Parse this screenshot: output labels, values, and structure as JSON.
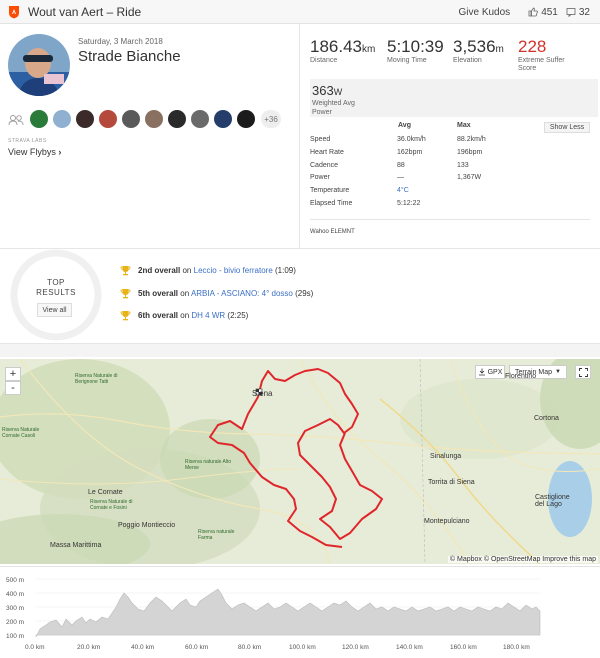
{
  "header": {
    "title": "Wout van Aert – Ride",
    "give_kudos": "Give Kudos",
    "kudos_count": "451",
    "comments_count": "32"
  },
  "activity": {
    "date": "Saturday, 3 March 2018",
    "name": "Strade Bianche",
    "more_athletes": "+36",
    "flyby_label": "STRAVA LABS",
    "flyby_link": "View Flybys"
  },
  "stats": {
    "distance": {
      "value": "186.43",
      "unit": "km",
      "label": "Distance"
    },
    "moving_time": {
      "value": "5:10:39",
      "label": "Moving Time"
    },
    "elevation": {
      "value": "3,536",
      "unit": "m",
      "label": "Elevation"
    },
    "suffer": {
      "value": "228",
      "label": "Extreme Suffer Score"
    },
    "power": {
      "value": "363",
      "unit": "W",
      "label": "Weighted Avg Power"
    },
    "show_less": "Show Less",
    "table": {
      "col_avg": "Avg",
      "col_max": "Max",
      "rows": [
        {
          "label": "Speed",
          "avg": "36.0km/h",
          "max": "88.2km/h"
        },
        {
          "label": "Heart Rate",
          "avg": "162bpm",
          "max": "196bpm"
        },
        {
          "label": "Cadence",
          "avg": "88",
          "max": "133"
        },
        {
          "label": "Power",
          "avg": "—",
          "max": "1,367W"
        },
        {
          "label": "Temperature",
          "avg": "4°C",
          "max": ""
        },
        {
          "label": "Elapsed Time",
          "avg": "5:12:22",
          "max": ""
        }
      ]
    },
    "device": "Wahoo ELEMNT"
  },
  "top_results": {
    "title_line1": "TOP",
    "title_line2": "RESULTS",
    "view_all": "View all",
    "items": [
      {
        "rank": "2nd overall",
        "on": "on",
        "segment": "Leccio - bivio ferratore",
        "time": "(1:09)"
      },
      {
        "rank": "5th overall",
        "on": "on",
        "segment": "ARBIA - ASCIANO: 4° dosso",
        "time": "(29s)"
      },
      {
        "rank": "6th overall",
        "on": "on",
        "segment": "DH 4 WR",
        "time": "(2:25)"
      }
    ]
  },
  "map": {
    "zoom_in": "+",
    "zoom_out": "-",
    "gpx": "GPX",
    "terrain": "Terrain Map",
    "labels": {
      "siena": "Siena",
      "sinalunga": "Sinalunga",
      "cortona": "Cortona",
      "florentino": "Florentino",
      "torrita": "Torrita di Siena",
      "montepulciano": "Montepulciano",
      "castiglione": "Castiglione del Lago",
      "le_cornate": "Le Cornate",
      "poggio": "Poggio Montieccio",
      "massa": "Massa Marittima",
      "reserve1": "Riserva Naturale di Berignone Tatti",
      "reserve2": "Riserva Naturale di Cornate e Fosini",
      "reserve3": "Riserva naturale Alto Merse",
      "reserve4": "Riserva naturale Farma",
      "reserve5": "Riserva Naturale Cornate Casoli"
    },
    "attribution": "© Mapbox © OpenStreetMap Improve this map"
  },
  "elevation_chart": {
    "y_labels": [
      "500 m",
      "400 m",
      "300 m",
      "200 m",
      "100 m"
    ],
    "x_labels": [
      "0.0 km",
      "20.0 km",
      "40.0 km",
      "60.0 km",
      "80.0 km",
      "100.0 km",
      "120.0 km",
      "140.0 km",
      "160.0 km",
      "180.0 km"
    ]
  },
  "colors": {
    "accent": "#fc4c02",
    "suffer": "#d0332a",
    "link": "#3b6fc4",
    "route": "#e0262b",
    "trophy": "#e8b317"
  }
}
